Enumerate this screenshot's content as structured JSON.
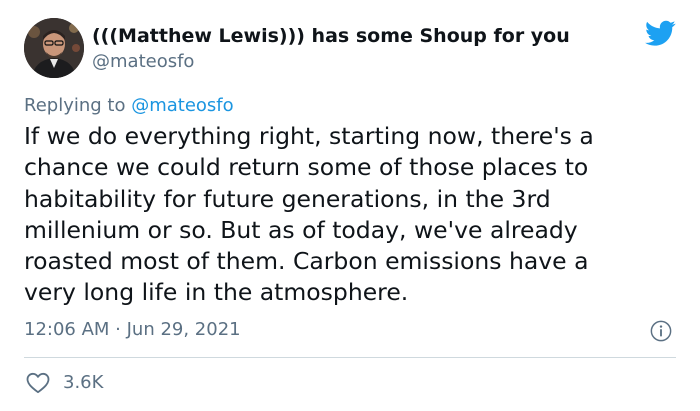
{
  "tweet": {
    "author": {
      "display_name": "(((Matthew Lewis))) has some Shoup for you",
      "handle": "@mateosfo",
      "avatar_icon": "profile-photo"
    },
    "brand": {
      "icon": "twitter-bird-icon",
      "color": "#1da1f2"
    },
    "reply_context": {
      "prefix": "Replying to ",
      "mention": "@mateosfo"
    },
    "text": "If we do everything right, starting now, there's a\nchance we could return some of those places to\nhabitability for future generations, in the 3rd\nmillenium or so. But as of today, we've already\nroasted most of them. Carbon emissions have a\nvery long life in the atmosphere.",
    "timestamp": "12:06 AM · Jun 29, 2021",
    "likes": {
      "icon": "heart-outline-icon",
      "count": "3.6K"
    },
    "info_icon": "info-circle-icon"
  },
  "colors": {
    "text_primary": "#0f1419",
    "text_secondary": "#5b7083",
    "link": "#1b95e0",
    "divider": "#cfd9de"
  }
}
